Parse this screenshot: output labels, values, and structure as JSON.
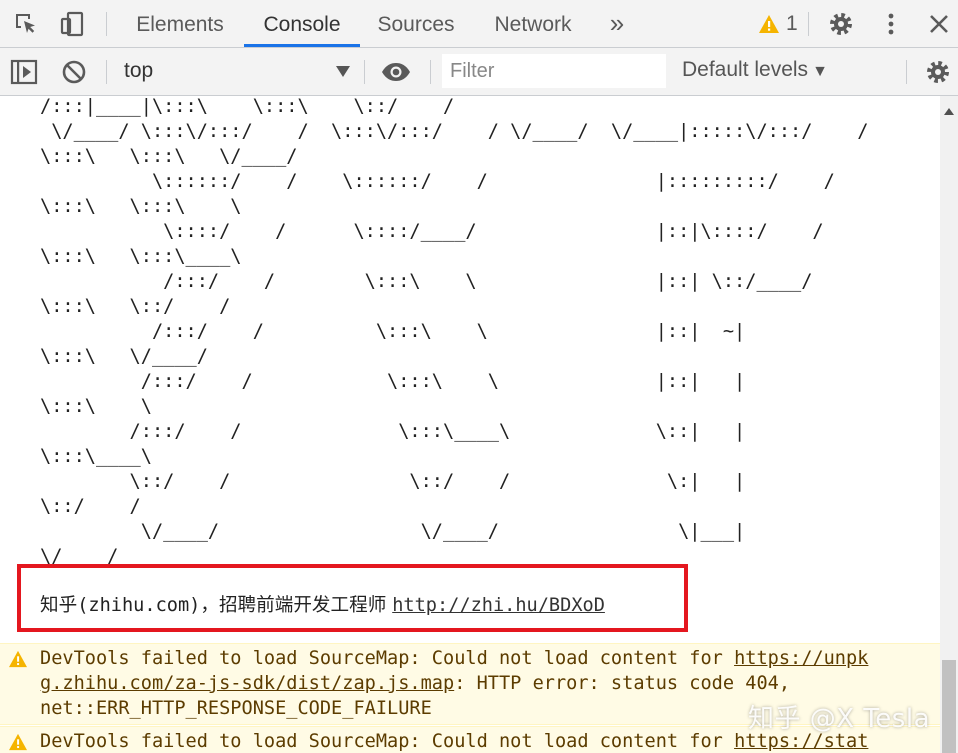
{
  "tabs": {
    "elements": "Elements",
    "console": "Console",
    "sources": "Sources",
    "network": "Network",
    "more": "»"
  },
  "warning_count": "1",
  "toolbar": {
    "context": "top",
    "filter_placeholder": "Filter",
    "levels": "Default levels",
    "levels_arrow": "▼"
  },
  "console": {
    "ascii_art": "/:::|____|\\:::\\    \\:::\\    \\::/    /\n \\/____/ \\:::\\/:::/    /  \\:::\\/:::/    / \\/____/  \\/____|:::::\\/:::/    /\n\\:::\\   \\:::\\   \\/____/\n          \\::::::/    /    \\::::::/    /               |:::::::::/    /\n\\:::\\   \\:::\\    \\\n           \\::::/    /      \\::::/____/                |::|\\::::/    /\n\\:::\\   \\:::\\____\\\n           /:::/    /        \\:::\\    \\                |::| \\::/____/\n\\:::\\   \\::/    /\n          /:::/    /          \\:::\\    \\               |::|  ~|\n\\:::\\   \\/____/\n         /:::/    /            \\:::\\    \\              |::|   |\n\\:::\\    \\\n        /:::/    /              \\:::\\____\\             \\::|   |\n\\:::\\____\\\n        \\::/    /                \\::/    /              \\:|   |\n\\::/    /\n         \\/____/                  \\/____/                \\|___|\n\\/____/",
    "recruit_prefix": "知乎",
    "recruit_domain": "(zhihu.com)",
    "recruit_text": "，招聘前端开发工程师 ",
    "recruit_link": "http://zhi.hu/BDXoD",
    "warnings": [
      {
        "prefix": "DevTools failed to load SourceMap: Could not load content for ",
        "link_part1": "https://unpk",
        "link_part2": "g.zhihu.com/za-js-sdk/dist/zap.js.map",
        "suffix": ": HTTP error: status code 404,",
        "line3": "net::ERR_HTTP_RESPONSE_CODE_FAILURE"
      },
      {
        "prefix": "DevTools failed to load SourceMap: Could not load content for ",
        "link_part1": "https://stat"
      }
    ]
  },
  "watermark": "知乎 @X Tesla",
  "colors": {
    "accent": "#1a73e8",
    "warning_bg": "#fffbe5",
    "warning_icon": "#f5b400",
    "highlight_box": "#e4171f"
  }
}
